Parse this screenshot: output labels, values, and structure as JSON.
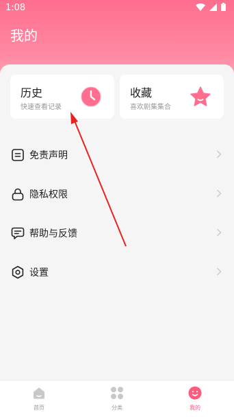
{
  "status": {
    "time": "1:08"
  },
  "header": {
    "title": "我的"
  },
  "cards": {
    "history": {
      "title": "历史",
      "subtitle": "快速查看记录",
      "icon": "clock-icon"
    },
    "favorites": {
      "title": "收藏",
      "subtitle": "喜欢剧集集合",
      "icon": "star-icon"
    }
  },
  "menu": [
    {
      "label": "免责声明",
      "icon": "document-icon"
    },
    {
      "label": "隐私权限",
      "icon": "lock-icon"
    },
    {
      "label": "帮助与反馈",
      "icon": "chat-icon"
    },
    {
      "label": "设置",
      "icon": "settings-icon"
    }
  ],
  "nav": [
    {
      "label": "首页",
      "icon": "home-icon"
    },
    {
      "label": "分类",
      "icon": "grid-icon"
    },
    {
      "label": "我的",
      "icon": "face-icon"
    }
  ],
  "colors": {
    "accent": "#ff5a7e",
    "header_top": "#ff6e8e",
    "header_bottom": "#ffc2cf"
  }
}
